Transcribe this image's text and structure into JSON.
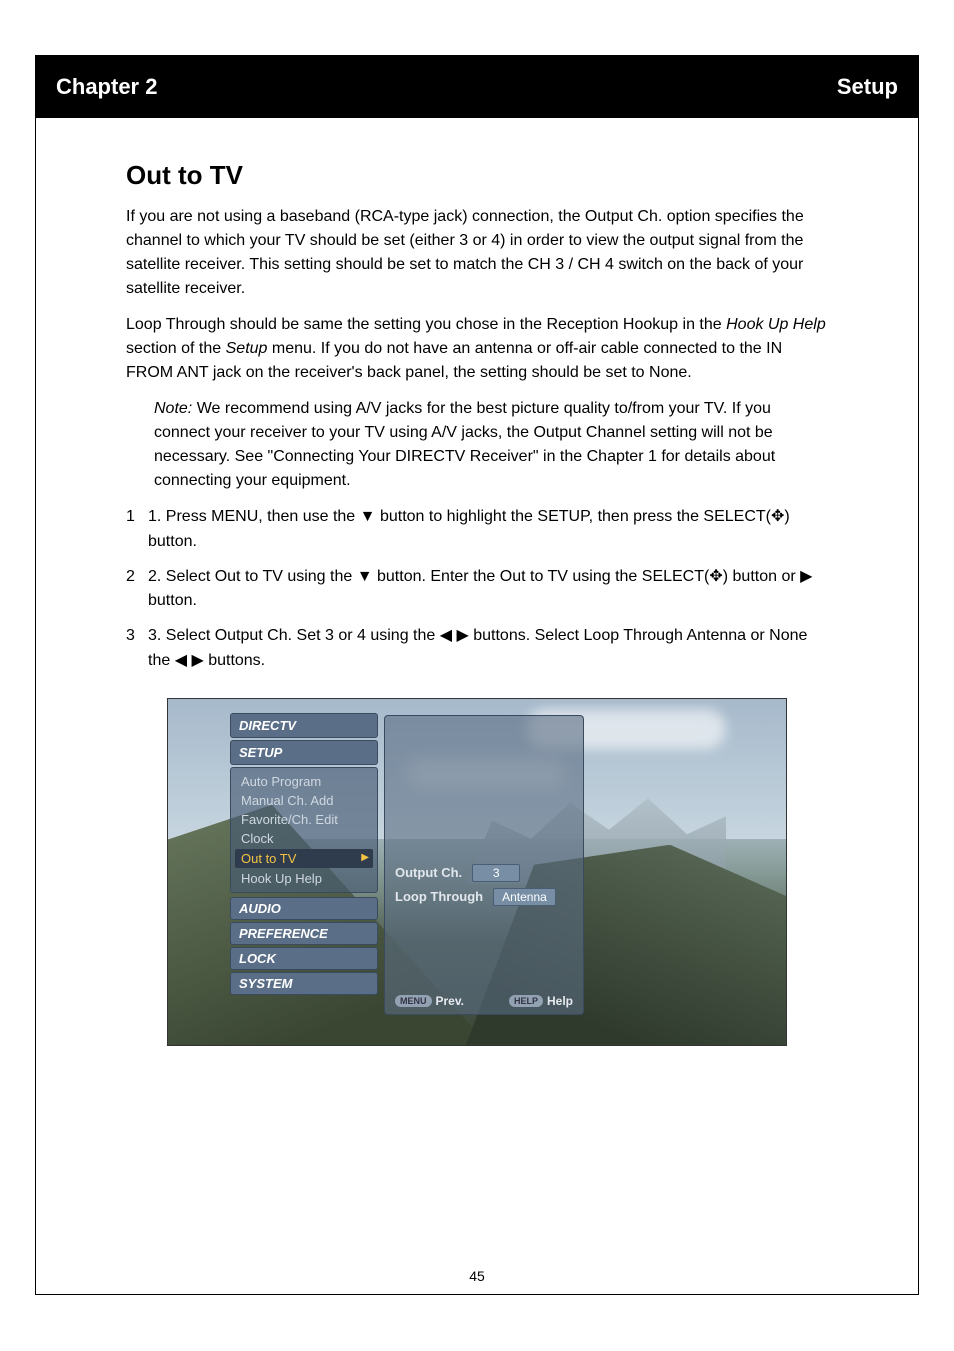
{
  "header": {
    "left": "Chapter 2",
    "right": "Setup"
  },
  "page_number": "45",
  "section": {
    "title": "Out to TV",
    "p1": "If you are not using a baseband (RCA-type jack) connection, the Output Ch. option specifies the channel to which your TV should be set (either 3 or 4) in order to view the output signal from the satellite receiver. This setting should be set to match the CH 3 / CH 4 switch on the back of your satellite receiver.",
    "p2_part1": "Loop Through should be same the setting you chose in the Reception Hookup in the ",
    "p2_link": "Hook Up Help",
    "p2_part2": " section of the ",
    "p2_link2": "Setup",
    "p2_part3": " menu. If you do not have an antenna or off-air cable connected to the IN FROM ANT jack on the receiver's back panel, the setting should be set to None.",
    "note": {
      "lead": "Note:",
      "text": "We recommend using A/V jacks for the best picture quality to/from your TV. If you connect your receiver to your TV using A/V jacks, the Output Channel setting will not be necessary. See \"Connecting Your DIRECTV Receiver\" in the Chapter 1 for details about connecting your equipment."
    },
    "step1_a": "1. Press MENU, then use the ",
    "step1_b": " button to highlight the SETUP, then press the SELECT(",
    "step1_c": ") button.",
    "step2_a": "2. Select Out to TV using the ",
    "step2_b": " button. Enter the Out to TV using the SELECT(",
    "step2_c": ") button or ",
    "step2_d": " button.",
    "step3_a": "3. Select Output Ch. Set 3 or 4 using the ",
    "step3_b": " buttons. Select Loop Through Antenna or None the ",
    "step3_c": " buttons."
  },
  "osd": {
    "sidebar": {
      "groups": [
        {
          "head": "DIRECTV"
        },
        {
          "head": "SETUP",
          "items": [
            "Auto Program",
            "Manual Ch. Add",
            "Favorite/Ch. Edit",
            "Clock",
            "Out to TV",
            "Hook Up Help"
          ],
          "highlight_index": 4
        }
      ],
      "collapsed": [
        "AUDIO",
        "PREFERENCE",
        "LOCK",
        "SYSTEM"
      ]
    },
    "panel": {
      "rows": [
        {
          "label": "Output Ch.",
          "value": "3"
        },
        {
          "label": "Loop Through",
          "value": "Antenna"
        }
      ]
    },
    "footer": {
      "left_pill": "MENU",
      "left_text": "Prev.",
      "right_pill": "HELP",
      "right_text": "Help"
    }
  }
}
